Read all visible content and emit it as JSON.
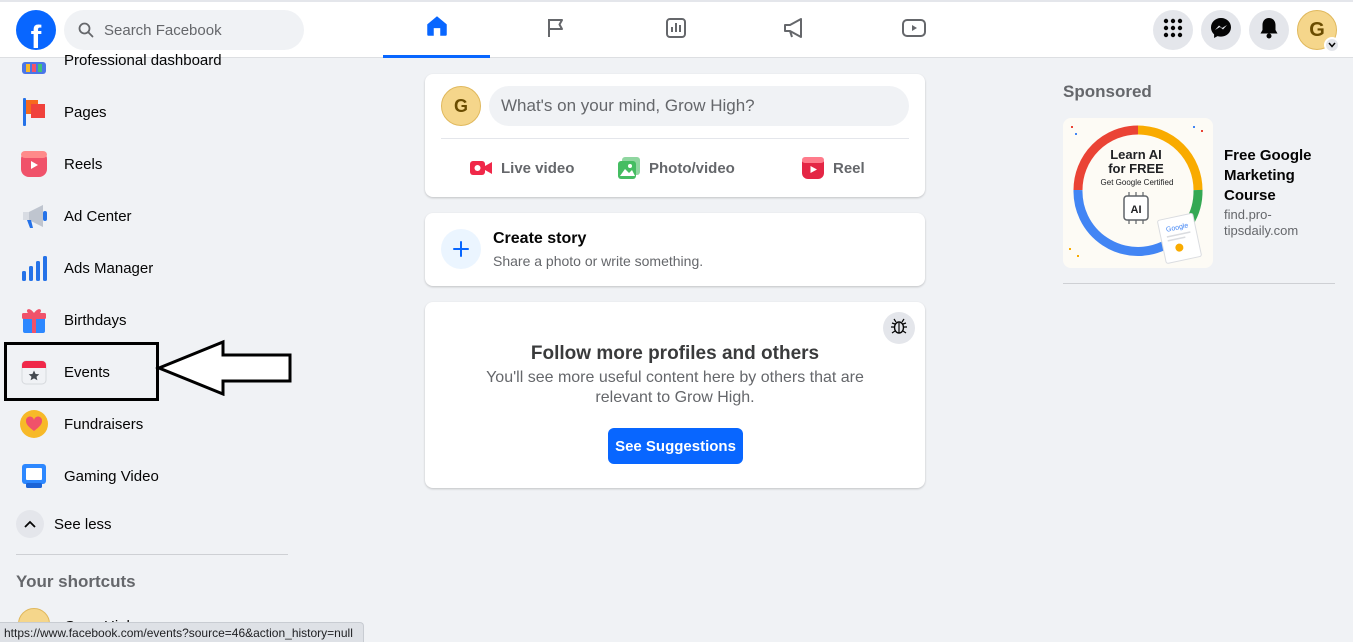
{
  "header": {
    "logo_letter": "f",
    "search": {
      "placeholder": "Search Facebook"
    },
    "tabs": [
      {
        "name": "home",
        "icon": "home-icon",
        "active": true
      },
      {
        "name": "pages",
        "icon": "flag-icon",
        "active": false
      },
      {
        "name": "insights",
        "icon": "chart-icon",
        "active": false
      },
      {
        "name": "ad-center",
        "icon": "megaphone-icon",
        "active": false
      },
      {
        "name": "video",
        "icon": "play-icon",
        "active": false
      }
    ],
    "right": {
      "menu_icon": "grid-icon",
      "messenger_icon": "messenger-icon",
      "notifications_icon": "bell-icon",
      "avatar_initial": "G"
    }
  },
  "sidebar": {
    "items": [
      {
        "label": "Professional dashboard",
        "icon": "dashboard-icon"
      },
      {
        "label": "Pages",
        "icon": "pages-icon"
      },
      {
        "label": "Reels",
        "icon": "reels-icon"
      },
      {
        "label": "Ad Center",
        "icon": "megaphone-icon"
      },
      {
        "label": "Ads Manager",
        "icon": "bar-chart-icon"
      },
      {
        "label": "Birthdays",
        "icon": "gift-icon"
      },
      {
        "label": "Events",
        "icon": "calendar-star-icon"
      },
      {
        "label": "Fundraisers",
        "icon": "heart-icon"
      },
      {
        "label": "Gaming Video",
        "icon": "gaming-icon"
      }
    ],
    "see_less": "See less",
    "shortcuts_title": "Your shortcuts",
    "shortcut_partial": "Grow High"
  },
  "composer": {
    "avatar_initial": "G",
    "placeholder": "What's on your mind, Grow High?",
    "actions": [
      {
        "label": "Live video",
        "icon": "live-video-icon",
        "color": "#f02849"
      },
      {
        "label": "Photo/video",
        "icon": "photo-icon",
        "color": "#45bd62"
      },
      {
        "label": "Reel",
        "icon": "reel-icon",
        "color": "#e42645"
      }
    ]
  },
  "story": {
    "plus": "+",
    "title": "Create story",
    "subtitle": "Share a photo or write something."
  },
  "follow": {
    "title": "Follow more profiles and others",
    "text": "You'll see more useful content here by others that are relevant to Grow High.",
    "button": "See Suggestions"
  },
  "sponsored": {
    "title": "Sponsored",
    "ad": {
      "image_lines": [
        "Learn AI",
        "for FREE",
        "Get Google Certified",
        "AI",
        "Google"
      ],
      "title": "Free Google Marketing Course",
      "domain": "find.pro-tipsdaily.com"
    }
  },
  "status_bar": "https://www.facebook.com/events?source=46&action_history=null",
  "colors": {
    "brand": "#0866ff",
    "background": "#f0f2f5",
    "annotation": "#000000"
  }
}
